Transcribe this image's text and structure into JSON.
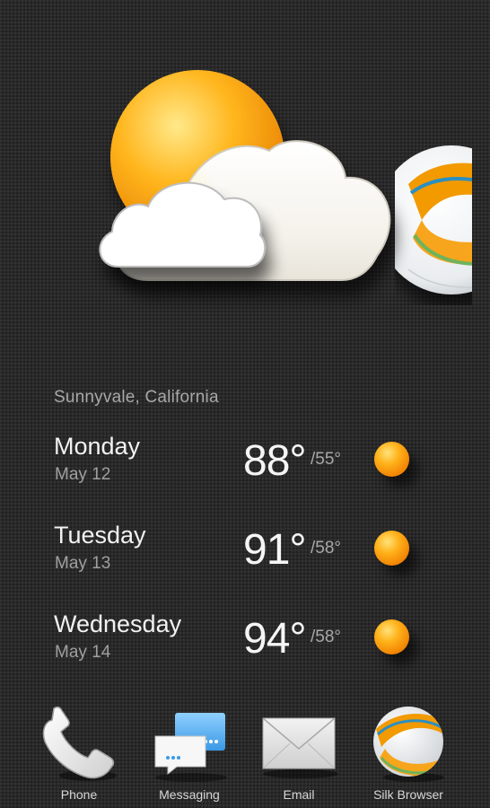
{
  "weather": {
    "location": "Sunnyvale, California",
    "days": [
      {
        "name": "Monday",
        "date": "May 12",
        "high": "88°",
        "low": "/55°",
        "icon": "sunny-icon"
      },
      {
        "name": "Tuesday",
        "date": "May 13",
        "high": "91°",
        "low": "/58°",
        "icon": "sunny-icon"
      },
      {
        "name": "Wednesday",
        "date": "May 14",
        "high": "94°",
        "low": "/58°",
        "icon": "sunny-icon"
      }
    ]
  },
  "dock": {
    "items": [
      {
        "label": "Phone",
        "icon": "phone-icon"
      },
      {
        "label": "Messaging",
        "icon": "messaging-icon"
      },
      {
        "label": "Email",
        "icon": "email-icon"
      },
      {
        "label": "Silk Browser",
        "icon": "silk-browser-icon"
      }
    ]
  },
  "colors": {
    "background": "#2a2a2a",
    "sun": "#ffb21a",
    "text_primary": "#f2f2f2",
    "text_secondary": "#a0a0a0"
  }
}
